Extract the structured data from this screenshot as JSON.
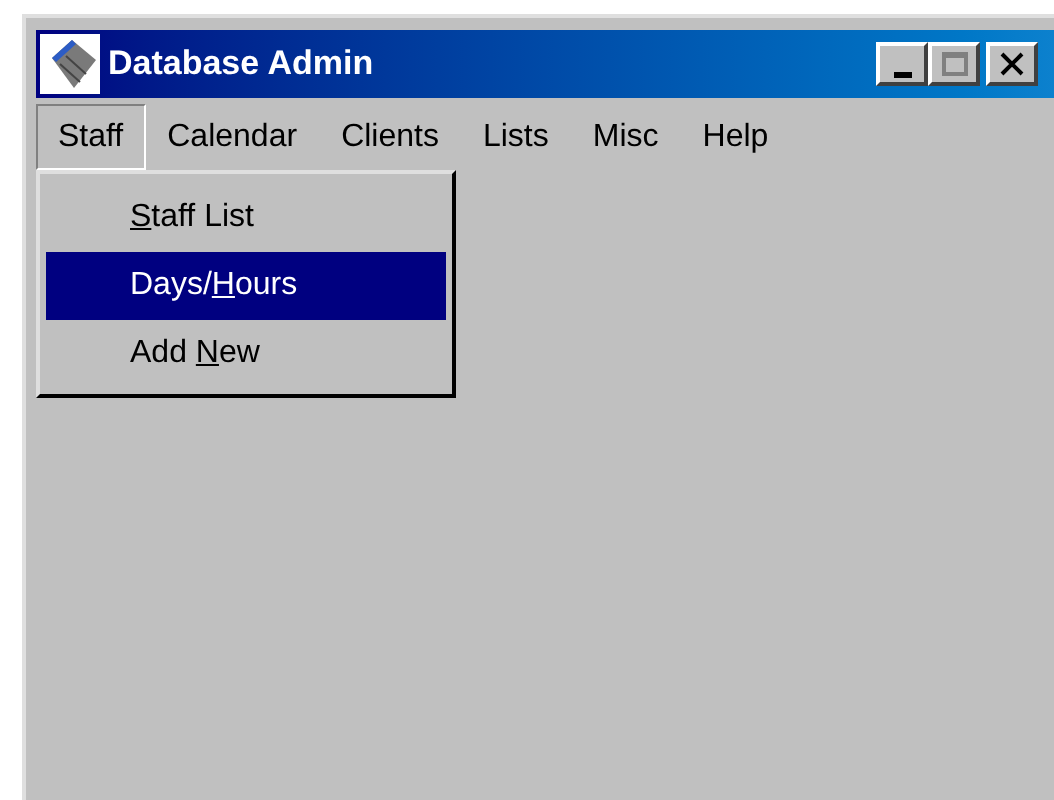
{
  "window": {
    "title": "Database Admin"
  },
  "menu_bar": [
    {
      "label": "Staff",
      "selected": true
    },
    {
      "label": "Calendar",
      "selected": false
    },
    {
      "label": "Clients",
      "selected": false
    },
    {
      "label": "Lists",
      "selected": false
    },
    {
      "label": "Misc",
      "selected": false
    },
    {
      "label": "Help",
      "selected": false
    }
  ],
  "dropdown": [
    {
      "key": "S",
      "after": "taff List",
      "selected": false
    },
    {
      "before": "Days/",
      "key": "H",
      "after": "ours",
      "selected": true
    },
    {
      "before": "Add ",
      "key": "N",
      "after": "ew",
      "selected": false
    }
  ]
}
